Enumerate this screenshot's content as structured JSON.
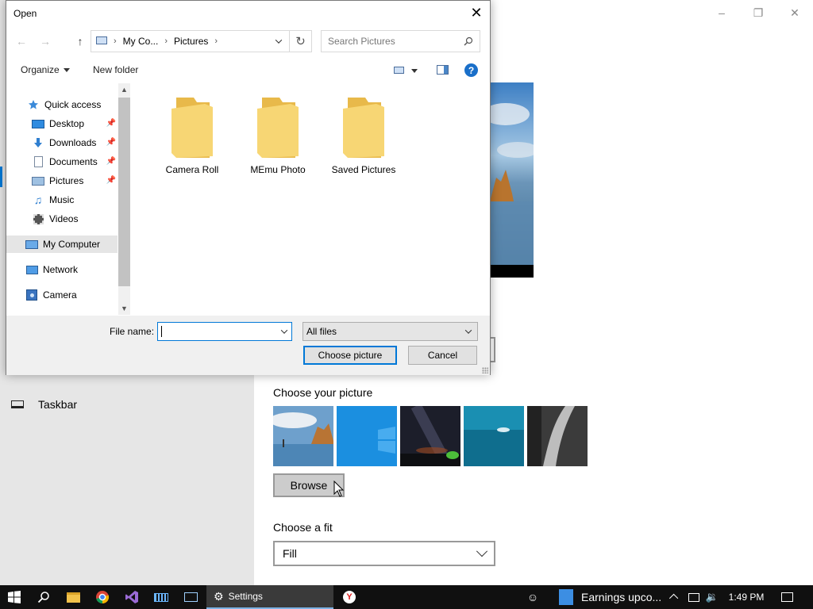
{
  "settings": {
    "left_nav": {
      "taskbar_label": "Taskbar"
    },
    "choose_picture_label": "Choose your picture",
    "browse_label": "Browse",
    "choose_fit_label": "Choose a fit",
    "fit_value": "Fill"
  },
  "dialog": {
    "title": "Open",
    "breadcrumb": [
      "My Co...",
      "Pictures"
    ],
    "search_placeholder": "Search Pictures",
    "toolbar": {
      "organize": "Organize",
      "new_folder": "New folder"
    },
    "nav_items": [
      {
        "label": "Quick access",
        "icon": "star-icon"
      },
      {
        "label": "Desktop",
        "icon": "desktop-icon",
        "pinned": true
      },
      {
        "label": "Downloads",
        "icon": "download-icon",
        "pinned": true
      },
      {
        "label": "Documents",
        "icon": "documents-icon",
        "pinned": true
      },
      {
        "label": "Pictures",
        "icon": "pictures-icon",
        "pinned": true
      },
      {
        "label": "Music",
        "icon": "music-icon"
      },
      {
        "label": "Videos",
        "icon": "videos-icon"
      },
      {
        "label": "My Computer",
        "icon": "computer-icon",
        "selected": true
      },
      {
        "label": "Network",
        "icon": "network-icon"
      },
      {
        "label": "Camera",
        "icon": "camera-icon"
      }
    ],
    "folders": [
      "Camera Roll",
      "MEmu Photo",
      "Saved Pictures"
    ],
    "file_name_label": "File name:",
    "file_name_value": "",
    "filter_value": "All files",
    "choose_button": "Choose picture",
    "cancel_button": "Cancel"
  },
  "taskbar": {
    "active_app": "Settings",
    "notification_app": "Earnings upco...",
    "time": "1:49 PM"
  },
  "colors": {
    "accent": "#0078d7",
    "folder": "#f5d57a",
    "taskbar_bg": "#101010"
  }
}
